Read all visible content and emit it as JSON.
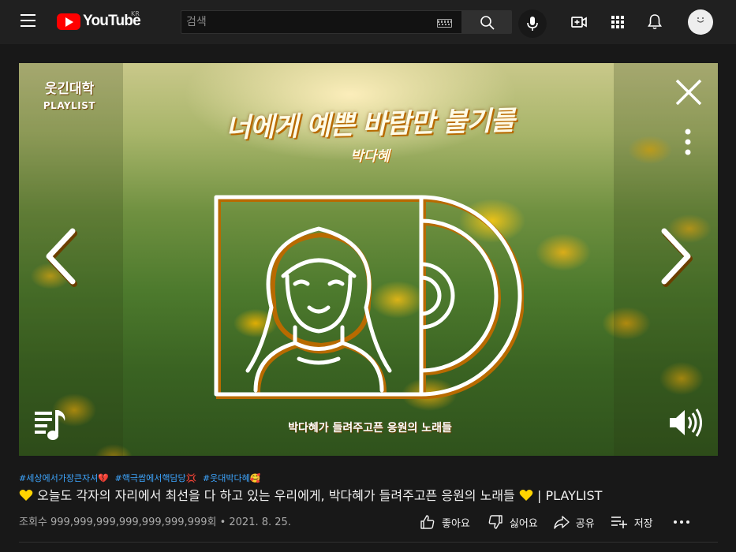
{
  "header": {
    "logo_text": "YouTube",
    "logo_region": "KR",
    "search_placeholder": "검색"
  },
  "player": {
    "brand_name": "웃긴대학",
    "brand_sub": "PLAYLIST",
    "song_title": "너에게 예쁜 바람만 불기를",
    "song_artist": "박다혜",
    "caption": "박다혜가 들려주고픈 응원의 노래들"
  },
  "video": {
    "hashtags": [
      "#세상에서가장큰자셔💔",
      "#핵극쌉에서핵담당💢",
      "#웃대박다혜🥰"
    ],
    "title": "오늘도 각자의 자리에서 최선을 다 하고 있는 우리에게, 박다혜가 들려주고픈 응원의 노래들",
    "title_suffix": "| PLAYLIST",
    "views": "조회수 999,999,999,999,999,999,999회 • 2021. 8. 25."
  },
  "actions": {
    "like_label": "좋아요",
    "dislike_label": "싫어요",
    "share_label": "공유",
    "save_label": "저장"
  },
  "colors": {
    "background": "#181818",
    "header": "#202020",
    "brand_red": "#ff0000",
    "hashtag_blue": "#3ea6ff",
    "heart_yellow": "#ffd400",
    "secondary_text": "#aaaaaa"
  },
  "icons": [
    "menu-icon",
    "youtube-logo-icon",
    "keyboard-icon",
    "search-icon",
    "mic-icon",
    "create-video-icon",
    "apps-icon",
    "bell-icon",
    "avatar",
    "close-icon",
    "more-vert-icon",
    "chevron-left-icon",
    "chevron-right-icon",
    "playlist-icon",
    "volume-icon",
    "heart-icon",
    "thumbs-up-icon",
    "thumbs-down-icon",
    "share-icon",
    "add-to-playlist-icon",
    "more-horiz-icon"
  ]
}
